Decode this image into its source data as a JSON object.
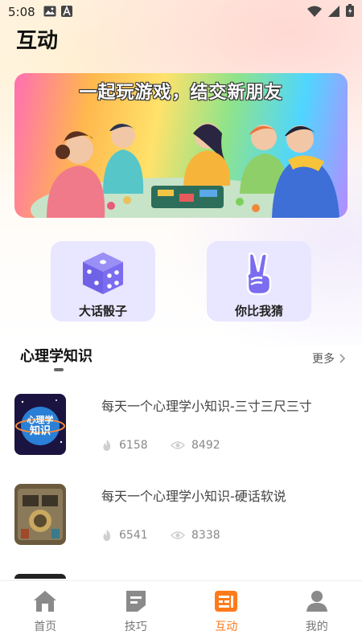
{
  "status_bar": {
    "time": "5:08"
  },
  "page_title": "互动",
  "banner": {
    "headline": "一起玩游戏，结交新朋友"
  },
  "features": [
    {
      "label": "大话骰子",
      "icon": "dice-icon"
    },
    {
      "label": "你比我猜",
      "icon": "victory-hand-icon"
    }
  ],
  "section": {
    "title": "心理学知识",
    "more_label": "更多"
  },
  "articles": [
    {
      "title": "每天一个心理学小知识-三寸三尺三寸",
      "likes": "6158",
      "views": "8492",
      "thumb_text": "心理学知识"
    },
    {
      "title": "每天一个心理学小知识-硬话软说",
      "likes": "6541",
      "views": "8338",
      "thumb_text": ""
    }
  ],
  "tabs": [
    {
      "label": "首页",
      "icon": "home-icon",
      "active": false
    },
    {
      "label": "技巧",
      "icon": "tips-icon",
      "active": false
    },
    {
      "label": "互动",
      "icon": "interact-icon",
      "active": true
    },
    {
      "label": "我的",
      "icon": "profile-icon",
      "active": false
    }
  ],
  "colors": {
    "accent": "#ff7a1a",
    "card_bg": "#e9e6ff",
    "dice": "#7b6cf0"
  }
}
